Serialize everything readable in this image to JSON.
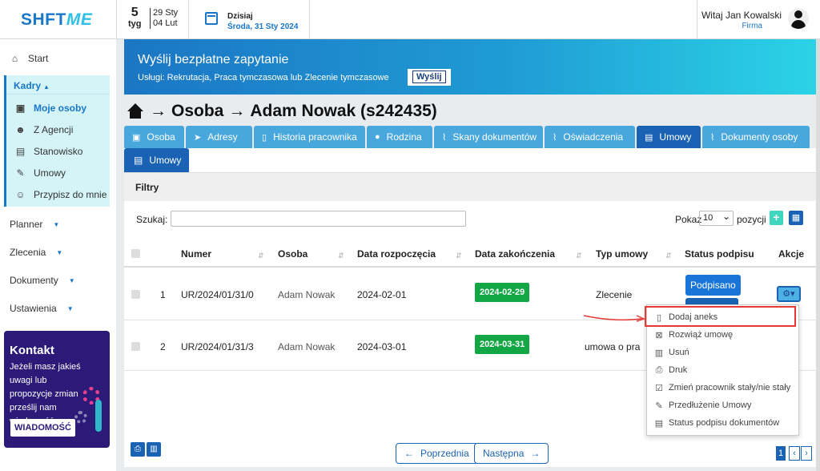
{
  "header": {
    "logo_a": "SHFT",
    "logo_b": "ME",
    "week_num": "5",
    "week_label": "tyg",
    "week_start": "29 Sty",
    "week_end": "04 Lut",
    "today_label": "Dzisiaj",
    "today_date": "Środa, 31 Sty 2024",
    "greeting": "Witaj Jan Kowalski",
    "company": "Firma"
  },
  "sidebar": {
    "start": "Start",
    "kadry": "Kadry",
    "kadry_items": [
      "Moje osoby",
      "Z Agencji",
      "Stanowisko",
      "Umowy",
      "Przypisz do mnie"
    ],
    "planner": "Planner",
    "zlecenia": "Zlecenia",
    "dokumenty": "Dokumenty",
    "ustawienia": "Ustawienia",
    "promo_title": "Kontakt",
    "promo_text": "Jeżeli masz jakieś uwagi lub propozycje zmian prześlij nam wiadomość",
    "promo_button": "WIADOMOŚĆ"
  },
  "banner": {
    "title": "Wyślij bezpłatne zapytanie",
    "subtitle": "Usługi: Rekrutacja, Praca tymczasowa lub Zlecenie tymczasowe",
    "button": "Wyślij"
  },
  "breadcrumb": {
    "part1": "Osoba",
    "part2": "Adam Nowak (s242435)"
  },
  "tabs": [
    "Osoba",
    "Adresy",
    "Historia pracownika",
    "Rodzina",
    "Skany dokumentów",
    "Oświadczenia",
    "Umowy",
    "Dokumenty osoby"
  ],
  "subtab": "Umowy",
  "filters_label": "Filtry",
  "search": {
    "label": "Szukaj:",
    "value": ""
  },
  "pagesize": {
    "label": "Pokaż",
    "value": "10",
    "suffix": "pozycji"
  },
  "table": {
    "headers": [
      "Numer",
      "Osoba",
      "Data rozpoczęcia",
      "Data zakończenia",
      "Typ umowy",
      "Status podpisu",
      "Akcje"
    ],
    "rows": [
      {
        "no": "1",
        "numer": "UR/2024/01/31/0",
        "osoba": "Adam Nowak",
        "start": "2024-02-01",
        "end": "2024-02-29",
        "typ": "Zlecenie",
        "status": "Podpisano"
      },
      {
        "no": "2",
        "numer": "UR/2024/01/31/3",
        "osoba": "Adam Nowak",
        "start": "2024-03-01",
        "end": "2024-03-31",
        "typ": "umowa o pra",
        "status": ""
      }
    ]
  },
  "dropdown": [
    "Dodaj aneks",
    "Rozwiąż umowę",
    "Usuń",
    "Druk",
    "Zmień pracownik stały/nie stały",
    "Przedłużenie Umowy",
    "Status podpisu dokumentów"
  ],
  "pagination": {
    "prev": "Poprzednia",
    "next": "Następna",
    "page": "1"
  },
  "colors": {
    "primary": "#1a62b4",
    "tab": "#48a7dc",
    "success": "#12a644",
    "highlight": "#e53935"
  }
}
